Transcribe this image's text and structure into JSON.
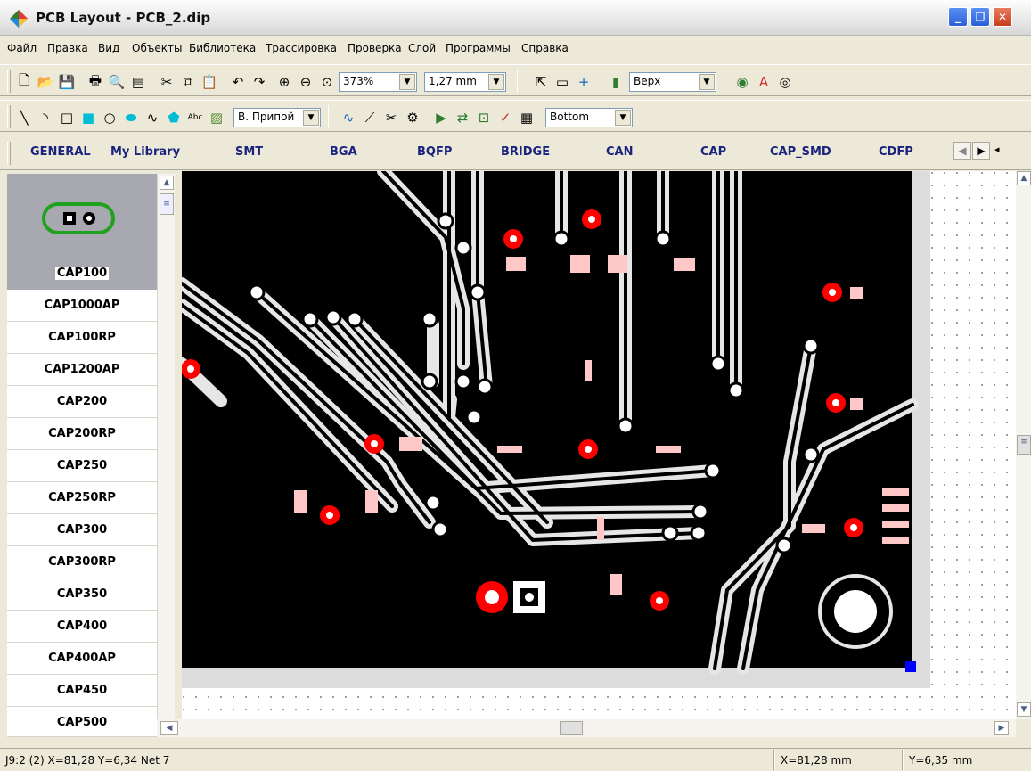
{
  "window": {
    "title": "PCB Layout - PCB_2.dip"
  },
  "menu": [
    "Файл",
    "Правка",
    "Вид",
    "Объекты",
    "Библиотека",
    "Трассировка",
    "Проверка",
    "Слой",
    "Программы",
    "Справка"
  ],
  "toolbar1": {
    "zoom": "373%",
    "grid": "1,27 mm",
    "layer": "Верх"
  },
  "toolbar2": {
    "text_tool": "Abc",
    "pad_style": "В. Припой",
    "bottom_layer": "Bottom"
  },
  "library_tabs": [
    "GENERAL",
    "My Library",
    "SMT",
    "BGA",
    "BQFP",
    "BRIDGE",
    "CAN",
    "CAP",
    "CAP_SMD",
    "CDFP"
  ],
  "component_preview": {
    "name": "CAP100"
  },
  "components": [
    "CAP1000AP",
    "CAP100RP",
    "CAP1200AP",
    "CAP200",
    "CAP200RP",
    "CAP250",
    "CAP250RP",
    "CAP300",
    "CAP300RP",
    "CAP350",
    "CAP400",
    "CAP400AP",
    "CAP450",
    "CAP500"
  ],
  "status": {
    "info": "J9:2 (2)  X=81,28 Y=6,34  Net 7",
    "x": "X=81,28 mm",
    "y": "Y=6,35 mm"
  },
  "colors": {
    "board": "#000000",
    "trace": "#e6e6e6",
    "via": "#ff0000",
    "smd_pad": "#ffc8c8",
    "selection": "#0000ff"
  }
}
